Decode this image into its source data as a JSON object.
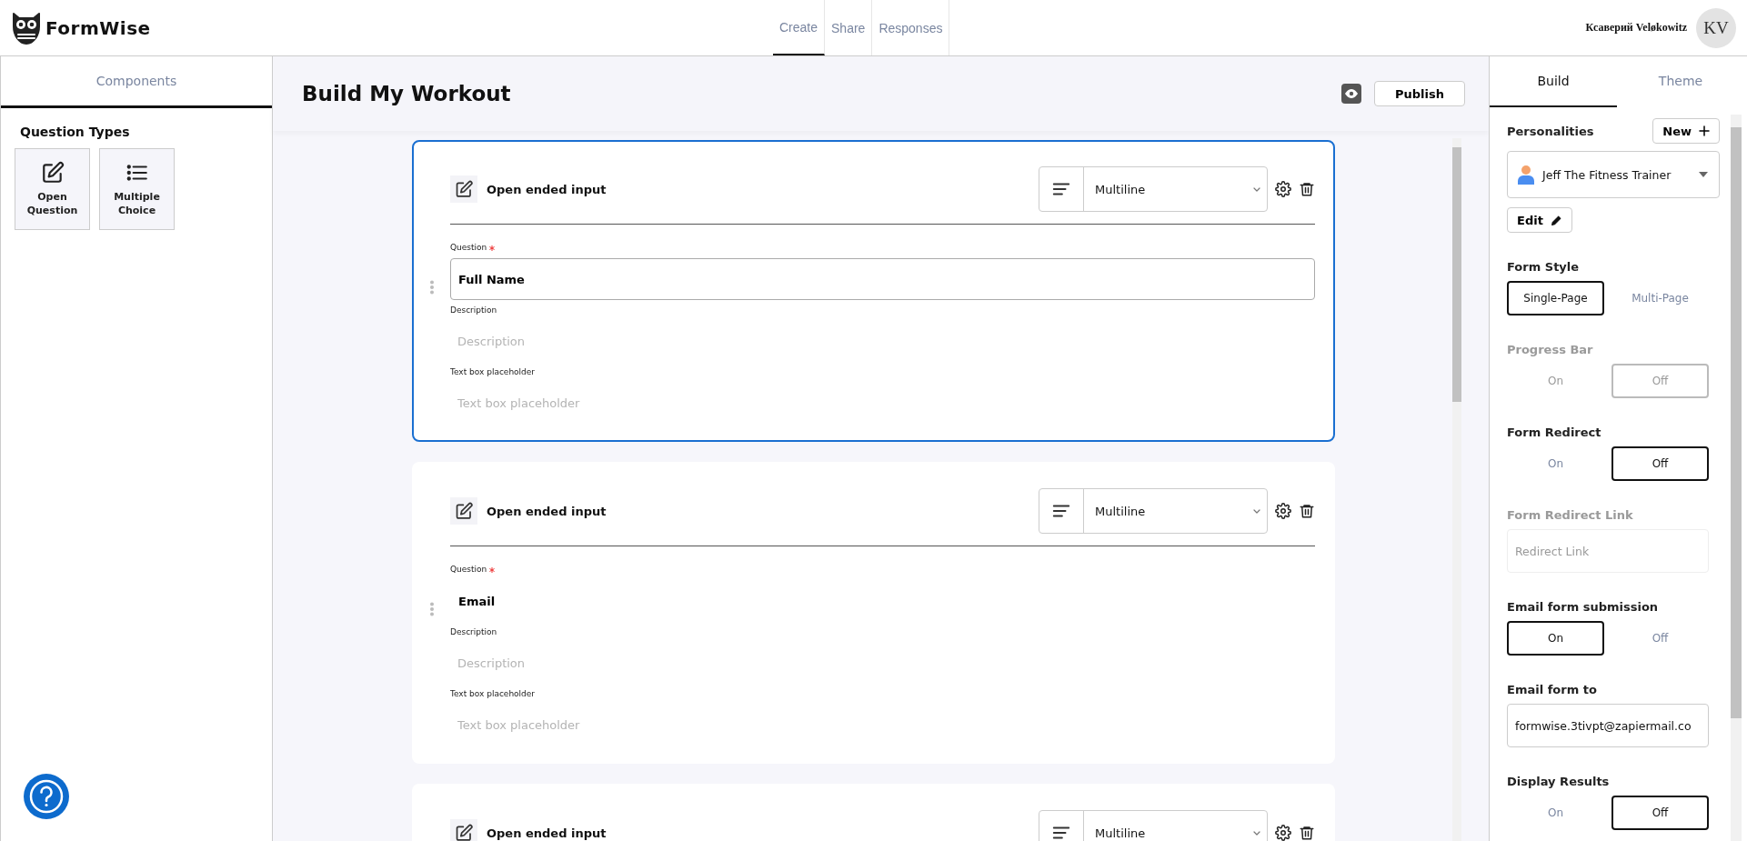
{
  "header": {
    "logo_text": "FormWise",
    "nav": [
      {
        "label": "Create",
        "selected": true
      },
      {
        "label": "Share",
        "selected": false
      },
      {
        "label": "Responses",
        "selected": false
      }
    ],
    "user_name": "Ксаверий Veløkowitz",
    "avatar_initials": "KV"
  },
  "left_panel": {
    "tabs": [
      {
        "label": "Components",
        "selected": true
      }
    ],
    "section_title": "Question Types",
    "components": [
      {
        "label": "Open Question",
        "kind": "open"
      },
      {
        "label": "Multiple Choice",
        "kind": "choice"
      }
    ]
  },
  "editor": {
    "title": "Build My Workout",
    "publish": "Publish",
    "cards": [
      {
        "title": "Open ended input",
        "type": "Multiline",
        "selected": true,
        "question_label": "Question",
        "required": true,
        "question_value": "Full Name",
        "description_label": "Description",
        "description_placeholder": "Description",
        "textbox_label": "Text box placeholder",
        "textbox_placeholder": "Text box placeholder"
      },
      {
        "title": "Open ended input",
        "type": "Multiline",
        "selected": false,
        "question_label": "Question",
        "required": true,
        "question_value": "Email",
        "description_label": "Description",
        "description_placeholder": "Description",
        "textbox_label": "Text box placeholder",
        "textbox_placeholder": "Text box placeholder"
      },
      {
        "title": "Open ended input",
        "type": "Multiline",
        "selected": false
      }
    ]
  },
  "right_panel": {
    "tabs": [
      {
        "label": "Build",
        "selected": true
      },
      {
        "label": "Theme",
        "selected": false
      }
    ],
    "personalities_label": "Personalities",
    "new_button": "New",
    "personality": "Jeff The Fitness Trainer",
    "edit_button": "Edit",
    "settings": [
      {
        "kind": "segmented",
        "label": "Form Style",
        "disabled": false,
        "options": [
          {
            "label": "Single-Page",
            "selected": true
          },
          {
            "label": "Multi-Page",
            "selected": false
          }
        ]
      },
      {
        "kind": "segmented",
        "label": "Progress Bar",
        "disabled": true,
        "options": [
          {
            "label": "On",
            "selected": false
          },
          {
            "label": "Off",
            "selected": true
          }
        ]
      },
      {
        "kind": "segmented",
        "label": "Form Redirect",
        "disabled": false,
        "options": [
          {
            "label": "On",
            "selected": false
          },
          {
            "label": "Off",
            "selected": true
          }
        ]
      },
      {
        "kind": "field",
        "label": "Form Redirect Link",
        "disabled": true,
        "placeholder": "Redirect Link"
      },
      {
        "kind": "segmented",
        "label": "Email form submission",
        "disabled": false,
        "options": [
          {
            "label": "On",
            "selected": true
          },
          {
            "label": "Off",
            "selected": false
          }
        ]
      },
      {
        "kind": "field",
        "label": "Email form to",
        "disabled": false,
        "value": "formwise.3tivpt@zapiermail.co"
      },
      {
        "kind": "segmented",
        "label": "Display Results",
        "disabled": false,
        "options": [
          {
            "label": "On",
            "selected": false
          },
          {
            "label": "Off",
            "selected": true
          }
        ]
      }
    ]
  }
}
